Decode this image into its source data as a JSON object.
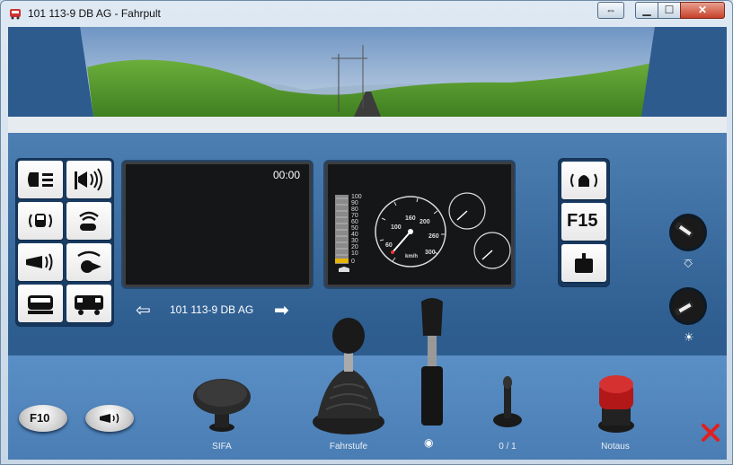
{
  "window": {
    "title": "101 113-9 DB AG - Fahrpult"
  },
  "left_panel": {
    "buttons": [
      {
        "icon": "headlight-icon"
      },
      {
        "icon": "horn-loud-icon"
      },
      {
        "icon": "door-warning-icon"
      },
      {
        "icon": "speaker-announce-icon"
      },
      {
        "icon": "horn-icon"
      },
      {
        "icon": "coupler-icon"
      },
      {
        "icon": "locomotive-front-icon"
      },
      {
        "icon": "locomotive-side-icon"
      }
    ]
  },
  "display_left": {
    "time": "00:00"
  },
  "loco": {
    "name": "101 113-9 DB AG"
  },
  "gauge": {
    "bar_ticks": [
      "100",
      "90",
      "80",
      "70",
      "60",
      "50",
      "40",
      "30",
      "20",
      "10",
      "0"
    ],
    "speed_ticks": [
      "60",
      "100",
      "160",
      "200",
      "260",
      "300"
    ],
    "unit": "km/h"
  },
  "right_panel": {
    "buttons": [
      {
        "icon": "bell-icon"
      },
      {
        "label": "F15"
      },
      {
        "icon": "weight-icon"
      }
    ]
  },
  "bottom": {
    "f10": "F10",
    "sifa": "SIFA",
    "fahrstufe": "Fahrstufe",
    "switch": "0 / 1",
    "notaus": "Notaus"
  }
}
